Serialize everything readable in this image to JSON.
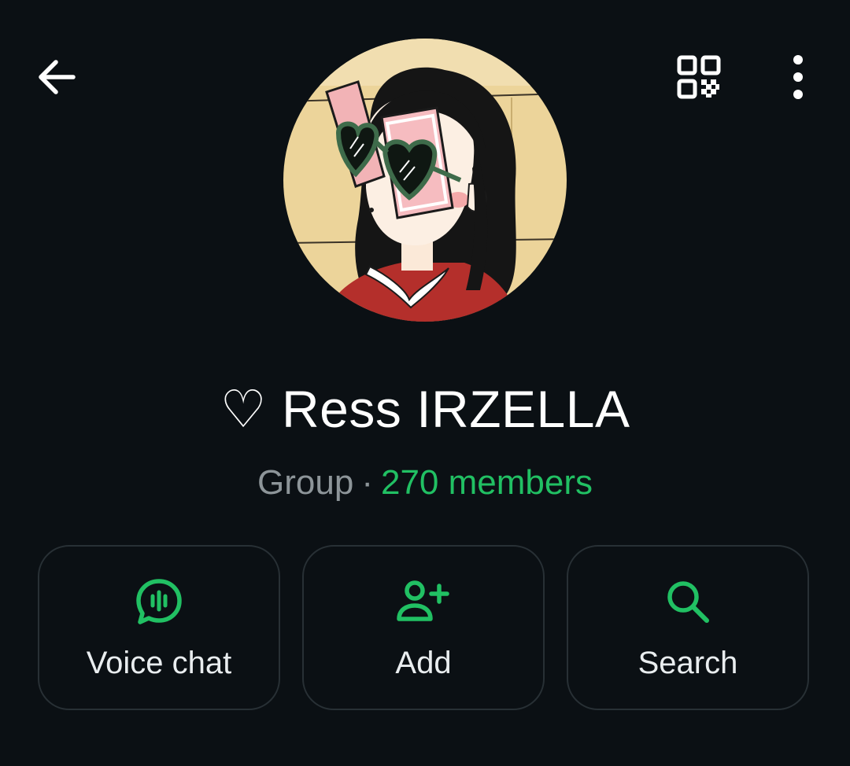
{
  "header": {
    "back_icon": "arrow-left-icon",
    "qr_icon": "qr-code-icon",
    "more_icon": "more-vertical-icon"
  },
  "profile": {
    "avatar_description_icon": "group-avatar-illustration",
    "name": "♡ Ress IRZELLA",
    "kind": "Group",
    "separator": "·",
    "members": "270 members"
  },
  "actions": [
    {
      "label": "Voice chat",
      "icon": "voice-chat-icon"
    },
    {
      "label": "Add",
      "icon": "add-person-icon"
    },
    {
      "label": "Search",
      "icon": "search-icon"
    }
  ],
  "colors": {
    "background": "#0b1014",
    "accent": "#21c063",
    "text_primary": "#ffffff",
    "text_secondary": "#8d9599",
    "card_border": "#283035"
  }
}
